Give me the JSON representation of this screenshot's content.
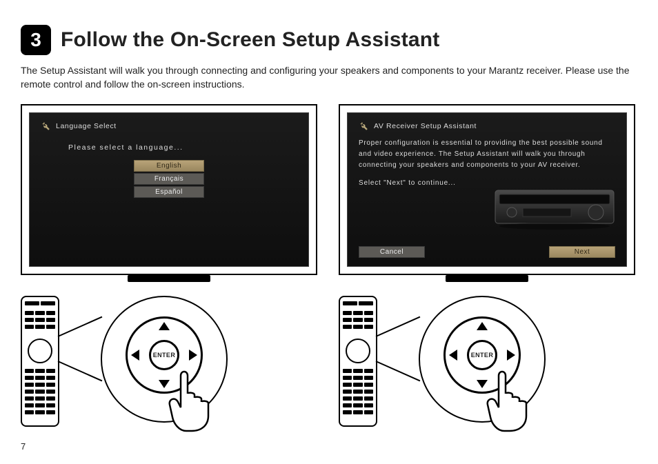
{
  "step": {
    "number": "3",
    "title": "Follow the On-Screen Setup Assistant"
  },
  "intro": "The Setup Assistant will walk you through connecting and configuring your speakers and components to your Marantz receiver. Please use the remote control and follow the on-screen instructions.",
  "screen_left": {
    "title": "Language Select",
    "prompt": "Please select a language...",
    "options": [
      "English",
      "Français",
      "Español"
    ],
    "selected_index": 0
  },
  "screen_right": {
    "title": "AV Receiver Setup Assistant",
    "body": "Proper configuration is essential to providing the best possible sound and video experience. The Setup Assistant will walk you through connecting your speakers and components to your AV receiver.",
    "select_prompt": "Select \"Next\" to continue...",
    "cancel_label": "Cancel",
    "next_label": "Next"
  },
  "remote": {
    "enter_label": "ENTER"
  },
  "page_number": "7"
}
